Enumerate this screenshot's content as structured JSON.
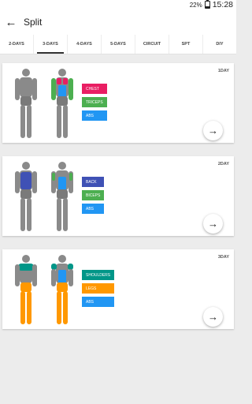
{
  "status_bar": {
    "battery_percent": "22%",
    "battery_level": 0.22,
    "time": "15:28"
  },
  "app_bar": {
    "back_icon": "arrow-left-icon",
    "title": "Split"
  },
  "tabs": [
    {
      "label": "2-DAYS",
      "active": false
    },
    {
      "label": "3-DAYS",
      "active": true
    },
    {
      "label": "4-DAYS",
      "active": false
    },
    {
      "label": "5-DAYS",
      "active": false
    },
    {
      "label": "CIRCUIT",
      "active": false
    },
    {
      "label": "SPT",
      "active": false
    },
    {
      "label": "DIY",
      "active": false
    }
  ],
  "cards": [
    {
      "day": "1DAY",
      "tags": [
        {
          "label": "CHEST",
          "color": "#e91e63"
        },
        {
          "label": "TRICEPS",
          "color": "#4caf50"
        },
        {
          "label": "ABS",
          "color": "#2196f3"
        }
      ]
    },
    {
      "day": "2DAY",
      "tags": [
        {
          "label": "BACK",
          "color": "#3f51b5"
        },
        {
          "label": "BICEPS",
          "color": "#4caf50"
        },
        {
          "label": "ABS",
          "color": "#2196f3"
        }
      ]
    },
    {
      "day": "3DAY",
      "tags": [
        {
          "label": "SHOULDERS",
          "color": "#009688"
        },
        {
          "label": "LEGS",
          "color": "#ff9800"
        },
        {
          "label": "ABS",
          "color": "#2196f3"
        }
      ]
    }
  ]
}
